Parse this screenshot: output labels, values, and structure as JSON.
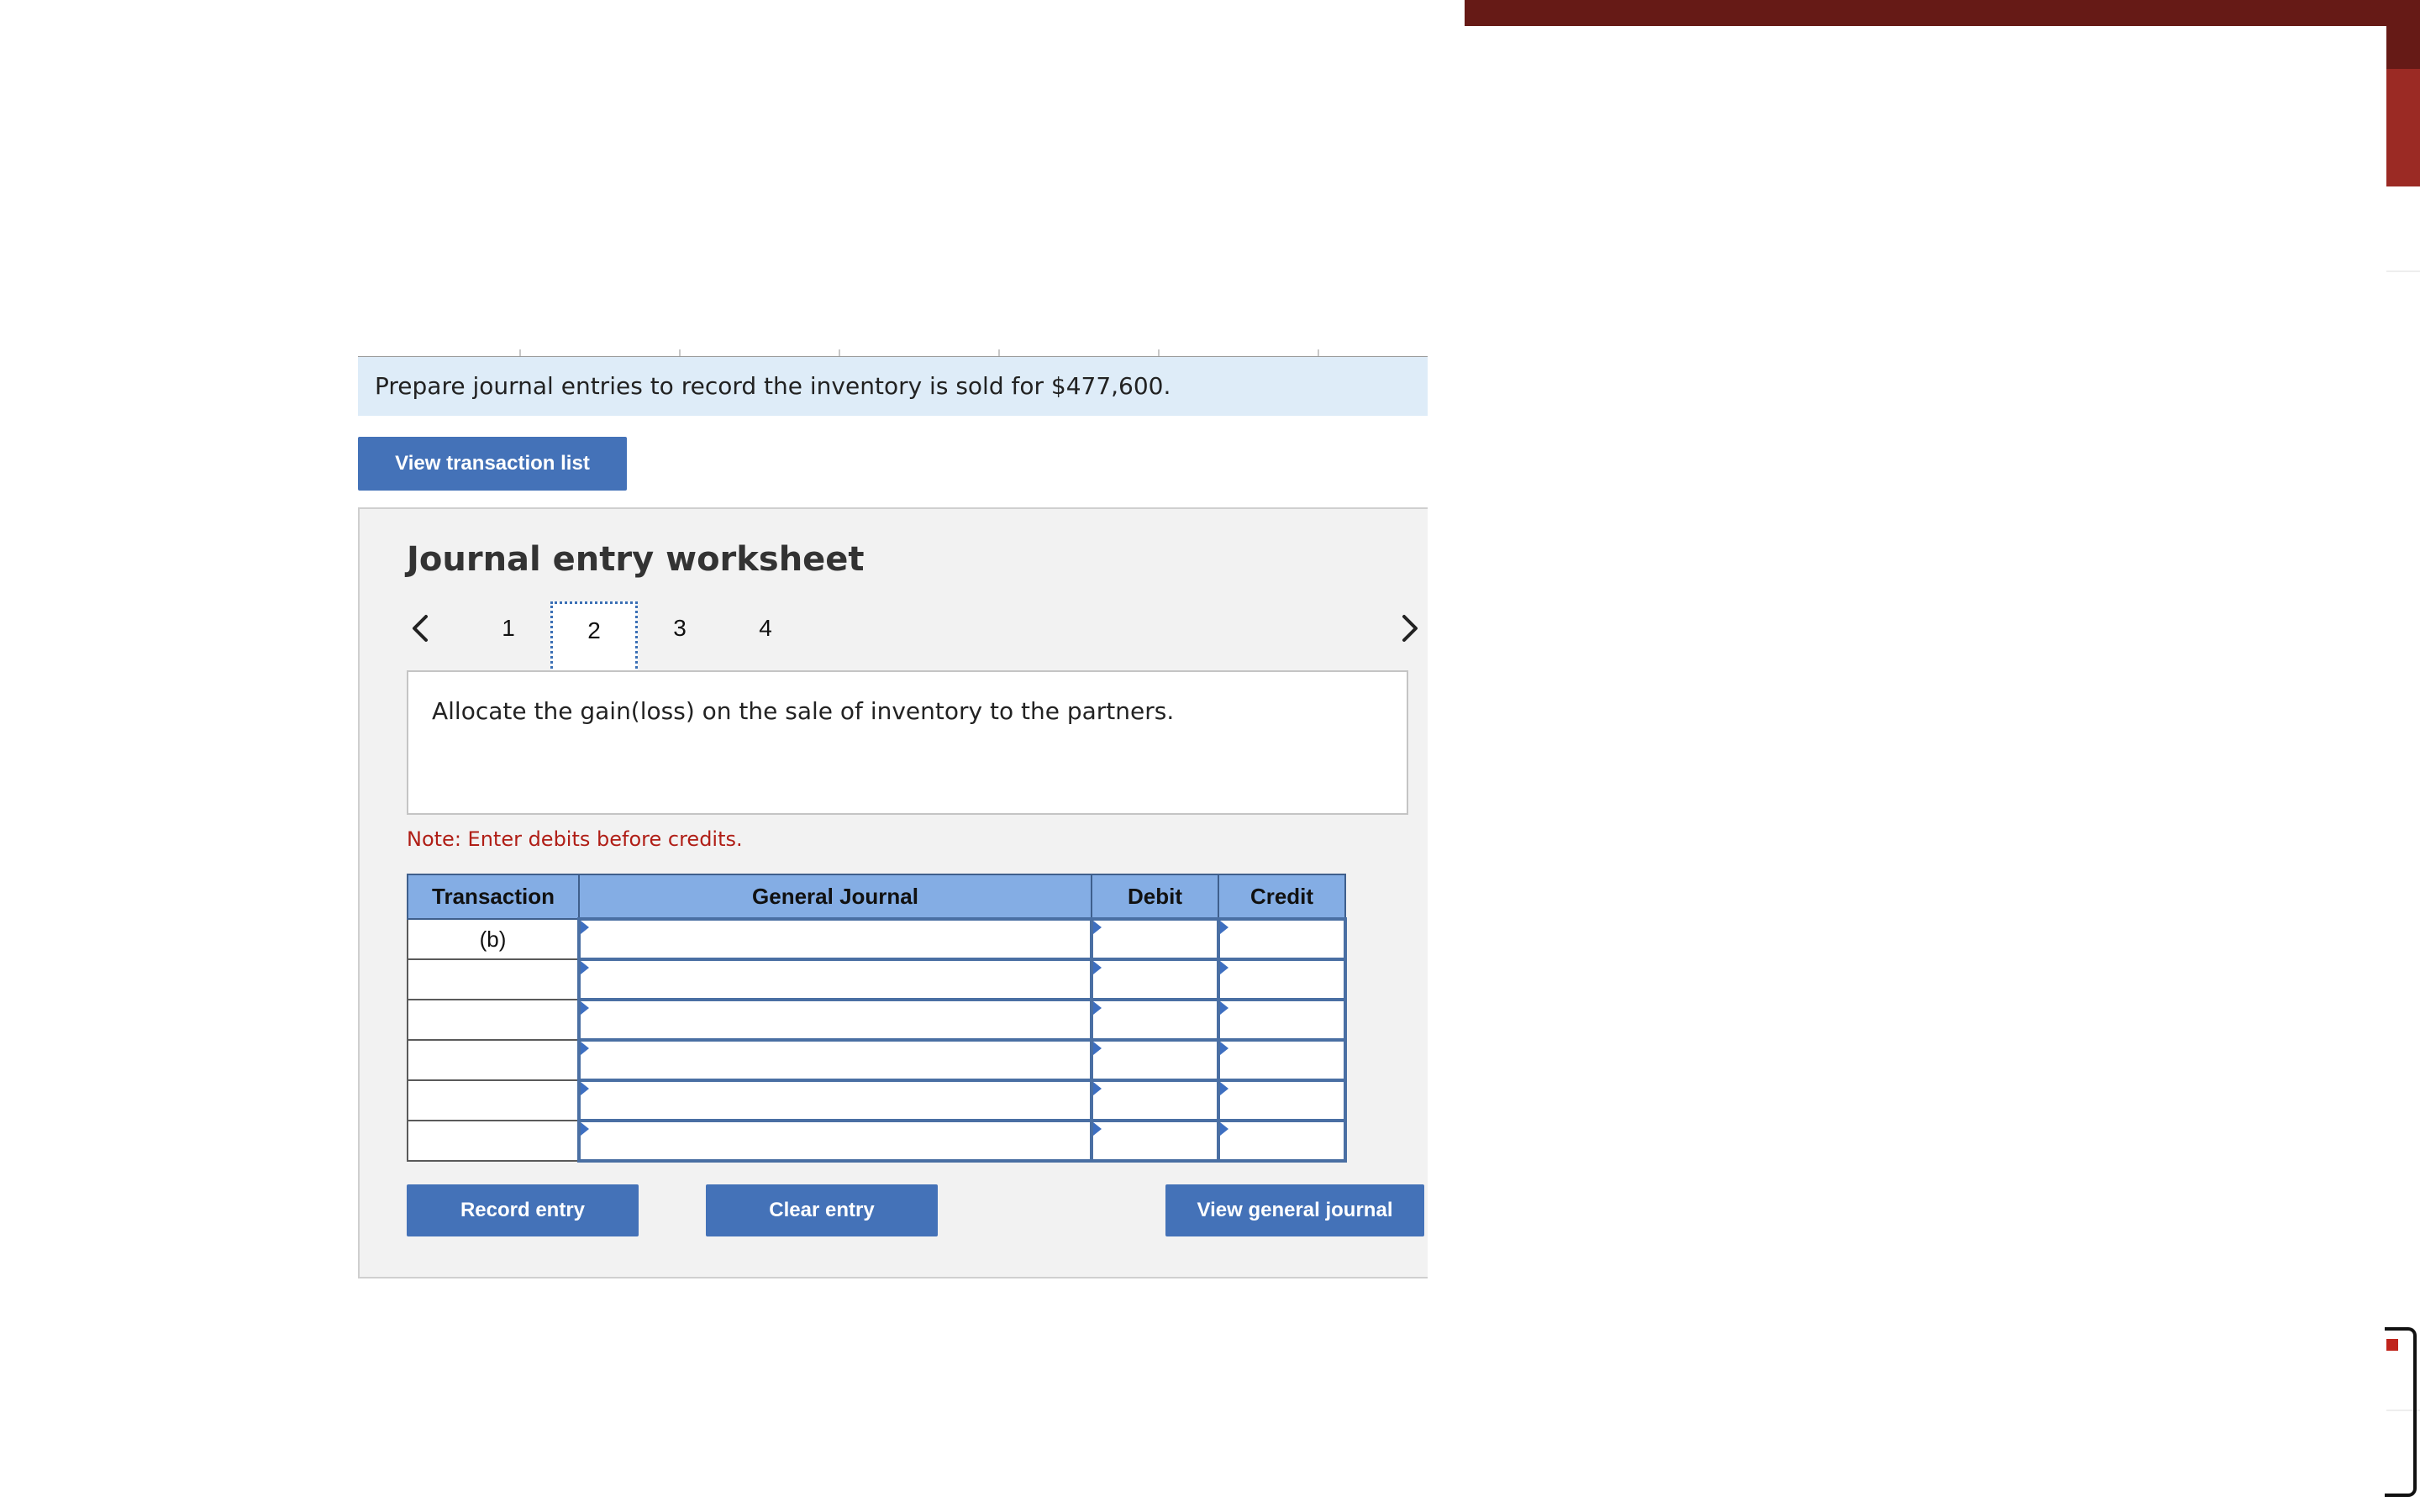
{
  "prompt": {
    "text": "Prepare journal entries to record the inventory is sold for $477,600."
  },
  "buttons": {
    "view_transaction_list": "View transaction list",
    "record_entry": "Record entry",
    "clear_entry": "Clear entry",
    "view_general_journal": "View general journal"
  },
  "worksheet": {
    "title": "Journal entry worksheet",
    "steps": [
      "1",
      "2",
      "3",
      "4"
    ],
    "active_step": "2",
    "instruction": "Allocate the gain(loss) on the sale of inventory to the partners.",
    "note": "Note: Enter debits before credits."
  },
  "table": {
    "headers": {
      "transaction": "Transaction",
      "general_journal": "General Journal",
      "debit": "Debit",
      "credit": "Credit"
    },
    "rows": [
      {
        "transaction": "(b)"
      },
      {
        "transaction": ""
      },
      {
        "transaction": ""
      },
      {
        "transaction": ""
      },
      {
        "transaction": ""
      },
      {
        "transaction": ""
      }
    ]
  },
  "icons": {
    "prev": "chevron-left-icon",
    "next": "chevron-right-icon"
  },
  "colors": {
    "button_blue": "#4472b8",
    "header_blue": "#84ade4",
    "prompt_bg": "#deecf8",
    "note_red": "#b01e16",
    "top_bar": "#661a16",
    "accent_red": "#9b2a24"
  }
}
